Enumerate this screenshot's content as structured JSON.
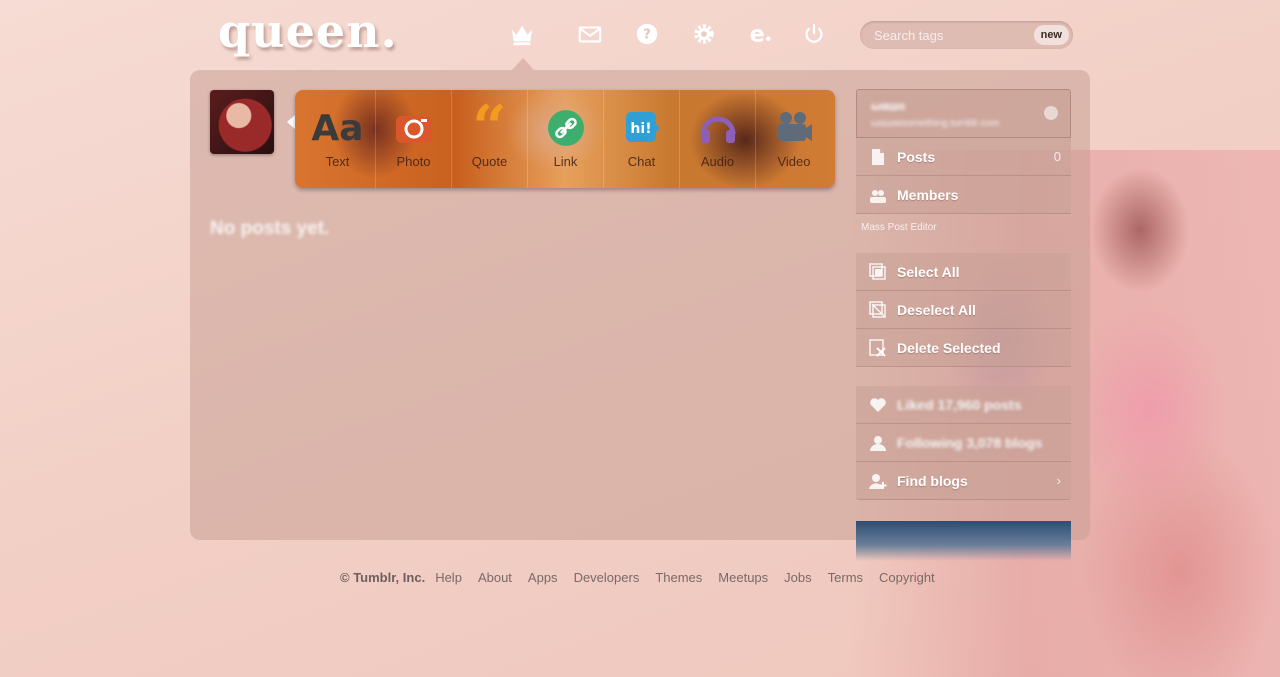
{
  "header": {
    "logo_text": "queen.",
    "nav_icons": [
      "crown-icon",
      "mail-icon",
      "help-icon",
      "gear-icon",
      "e-icon",
      "power-icon"
    ],
    "search": {
      "placeholder": "Search tags",
      "new_label": "new"
    }
  },
  "post_types": [
    {
      "label": "Text",
      "icon": "text-icon",
      "color": "#444444"
    },
    {
      "label": "Photo",
      "icon": "camera-icon",
      "color": "#d9572b"
    },
    {
      "label": "Quote",
      "icon": "quote-icon",
      "color": "#f29b1e"
    },
    {
      "label": "Link",
      "icon": "link-icon",
      "color": "#3dae6e"
    },
    {
      "label": "Chat",
      "icon": "chat-icon",
      "color": "#2f9fd6"
    },
    {
      "label": "Audio",
      "icon": "headphones-icon",
      "color": "#8e5fb8"
    },
    {
      "label": "Video",
      "icon": "video-camera-icon",
      "color": "#5f6b78"
    }
  ],
  "main": {
    "empty_message": "No posts yet."
  },
  "sidebar": {
    "blog_name": "ωαшιι",
    "blog_url": "ωαшιιιιsomething.tumblr.com",
    "posts": {
      "label": "Posts",
      "count": "0"
    },
    "members": {
      "label": "Members"
    },
    "mass_editor_label": "Mass Post Editor",
    "select_all": "Select All",
    "deselect_all": "Deselect All",
    "delete_selected": "Delete Selected",
    "liked": "Liked 17,960 posts",
    "following": "Following 3,078 blogs",
    "find_blogs": "Find blogs",
    "find_blogs_suffix": "›"
  },
  "footer": {
    "copyright": "© Tumblr, Inc.",
    "links": [
      "Help",
      "About",
      "Apps",
      "Developers",
      "Themes",
      "Meetups",
      "Jobs",
      "Terms",
      "Copyright"
    ]
  }
}
